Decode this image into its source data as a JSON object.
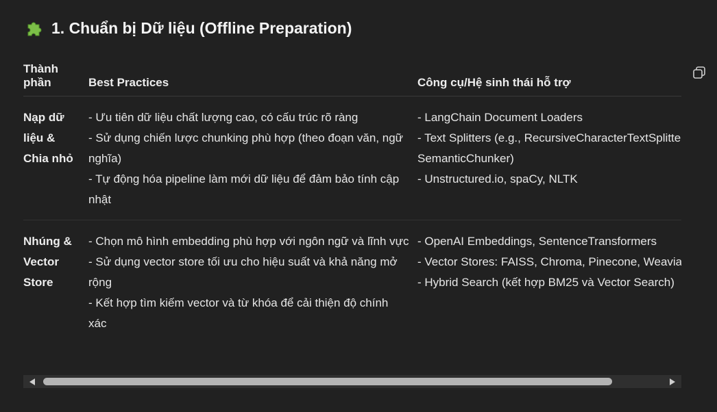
{
  "heading": {
    "icon": "puzzle-piece-icon",
    "text": "1. Chuẩn bị Dữ liệu (Offline Preparation)",
    "icon_color": "#7cbf48"
  },
  "table": {
    "headers": [
      "Thành phần",
      "Best Practices",
      "Công cụ/Hệ sinh thái hỗ trợ"
    ],
    "rows": [
      {
        "component": "Nạp dữ liệu & Chia nhỏ",
        "practices": [
          "- Ưu tiên dữ liệu chất lượng cao, có cấu trúc rõ ràng",
          "- Sử dụng chiến lược chunking phù hợp (theo đoạn văn, ngữ nghĩa)",
          "- Tự động hóa pipeline làm mới dữ liệu để đảm bảo tính cập nhật"
        ],
        "tools_lines": [
          "- LangChain Document Loaders",
          "- Text Splitters (e.g., RecursiveCharacterTextSplitter,",
          "SemanticChunker)",
          "- Unstructured.io, spaCy, NLTK"
        ]
      },
      {
        "component": "Nhúng & Vector Store",
        "practices": [
          "- Chọn mô hình embedding phù hợp với ngôn ngữ và lĩnh vực",
          "- Sử dụng vector store tối ưu cho hiệu suất và khả năng mở rộng",
          "- Kết hợp tìm kiếm vector và từ khóa để cải thiện độ chính xác"
        ],
        "tools_lines": [
          "- OpenAI Embeddings, SentenceTransformers",
          "- Vector Stores: FAISS, Chroma, Pinecone, Weaviate",
          "- Hybrid Search (kết hợp BM25 và Vector Search)"
        ]
      }
    ]
  },
  "toolbar": {
    "copy_icon": "copy-icon"
  },
  "scrollbar": {
    "left_arrow_icon": "scroll-left-arrow-icon",
    "right_arrow_icon": "scroll-right-arrow-icon"
  }
}
